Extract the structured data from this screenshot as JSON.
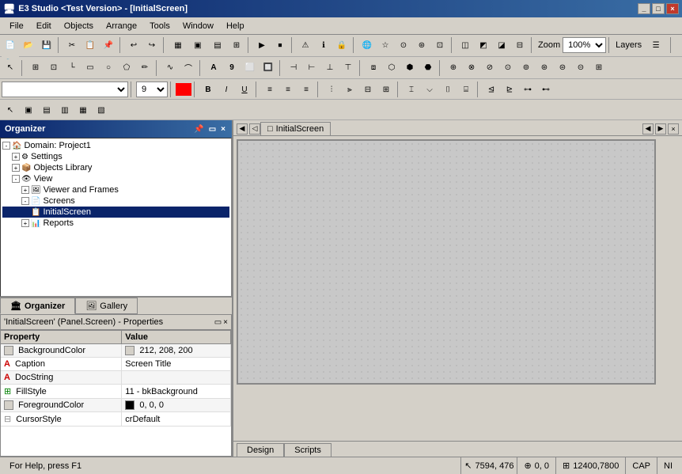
{
  "titlebar": {
    "title": "E3 Studio <Test Version> - [InitialScreen]",
    "btns": [
      "_",
      "□",
      "×"
    ]
  },
  "menubar": {
    "items": [
      "File",
      "Edit",
      "Objects",
      "Arrange",
      "Tools",
      "Window",
      "Help"
    ]
  },
  "toolbar1": {
    "zoom_label": "Zoom",
    "layers_label": "Layers"
  },
  "organizer": {
    "title": "Organizer",
    "tree": [
      {
        "label": "Domain: Project1",
        "indent": 0,
        "expand": "-",
        "icon": "🏠"
      },
      {
        "label": "Settings",
        "indent": 1,
        "expand": "+",
        "icon": "⚙"
      },
      {
        "label": "Objects Library",
        "indent": 1,
        "expand": "+",
        "icon": "📦"
      },
      {
        "label": "View",
        "indent": 1,
        "expand": "-",
        "icon": "👁"
      },
      {
        "label": "Viewer and Frames",
        "indent": 2,
        "expand": "+",
        "icon": "🖼"
      },
      {
        "label": "Screens",
        "indent": 2,
        "expand": "-",
        "icon": "📄"
      },
      {
        "label": "InitialScreen",
        "indent": 3,
        "expand": "",
        "icon": "📋",
        "selected": true
      },
      {
        "label": "Reports",
        "indent": 2,
        "expand": "+",
        "icon": "📊"
      }
    ],
    "tabs": [
      {
        "label": "Organizer",
        "icon": "🏛",
        "active": true
      },
      {
        "label": "Gallery",
        "icon": "🖼",
        "active": false
      }
    ]
  },
  "properties": {
    "title": "'InitialScreen' (Panel.Screen) - Properties",
    "columns": [
      "Property",
      "Value"
    ],
    "rows": [
      {
        "property": "BackgroundColor",
        "value": "212, 208, 200",
        "swatch": "#d4d0c8",
        "icon": "color"
      },
      {
        "property": "Caption",
        "value": "Screen Title",
        "icon": "text"
      },
      {
        "property": "DocString",
        "value": "",
        "icon": "text"
      },
      {
        "property": "FillStyle",
        "value": "11 - bkBackground",
        "icon": "fill"
      },
      {
        "property": "ForegroundColor",
        "value": "0, 0, 0",
        "swatch": "#000000",
        "icon": "color"
      },
      {
        "property": "CursorStyle",
        "value": "crDefault",
        "icon": "text"
      }
    ]
  },
  "canvas": {
    "tab_label": "InitialScreen",
    "nav_btns": [
      "◀",
      "▶",
      "▶▶",
      "×"
    ]
  },
  "bottom_tabs": [
    {
      "label": "Design",
      "active": true
    },
    {
      "label": "Scripts",
      "active": false
    }
  ],
  "statusbar": {
    "help_text": "For Help, press F1",
    "coordinates": "7594, 476",
    "offset": "0, 0",
    "size": "12400,7800",
    "caps": "CAP",
    "num": "NI"
  }
}
